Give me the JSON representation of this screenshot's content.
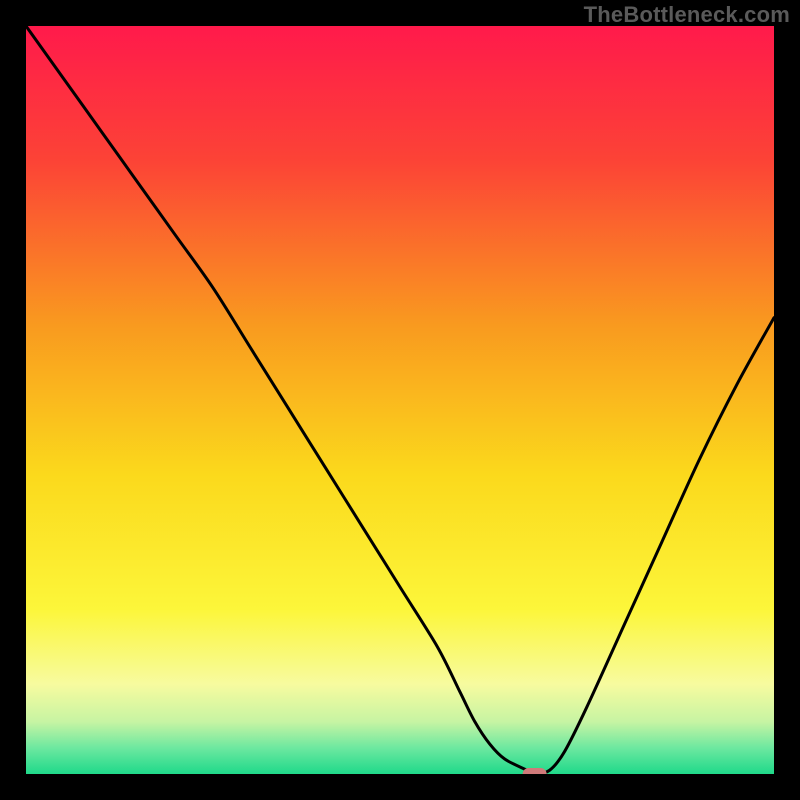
{
  "watermark": "TheBottleneck.com",
  "chart_data": {
    "type": "line",
    "title": "",
    "xlabel": "",
    "ylabel": "",
    "xlim": [
      0,
      100
    ],
    "ylim": [
      0,
      100
    ],
    "series": [
      {
        "name": "bottleneck-curve",
        "x": [
          0,
          5,
          10,
          15,
          20,
          25,
          30,
          35,
          40,
          45,
          50,
          55,
          58,
          60,
          62,
          64,
          67,
          68,
          70,
          72,
          75,
          80,
          85,
          90,
          95,
          100
        ],
        "y": [
          100,
          93,
          86,
          79,
          72,
          65,
          57,
          49,
          41,
          33,
          25,
          17,
          11,
          7,
          4,
          2,
          0.5,
          0,
          0.5,
          3,
          9,
          20,
          31,
          42,
          52,
          61
        ]
      }
    ],
    "marker": {
      "name": "optimal-point",
      "x": 68,
      "y": 0,
      "color": "#cf7a7a"
    },
    "background_gradient": {
      "stops": [
        {
          "offset": 0,
          "color": "#ff1a4b"
        },
        {
          "offset": 0.18,
          "color": "#fc4336"
        },
        {
          "offset": 0.4,
          "color": "#f99a1f"
        },
        {
          "offset": 0.6,
          "color": "#fbd91c"
        },
        {
          "offset": 0.78,
          "color": "#fcf63a"
        },
        {
          "offset": 0.88,
          "color": "#f7fb9f"
        },
        {
          "offset": 0.93,
          "color": "#c7f4a3"
        },
        {
          "offset": 0.965,
          "color": "#6de8a0"
        },
        {
          "offset": 1.0,
          "color": "#1fd98a"
        }
      ]
    }
  }
}
